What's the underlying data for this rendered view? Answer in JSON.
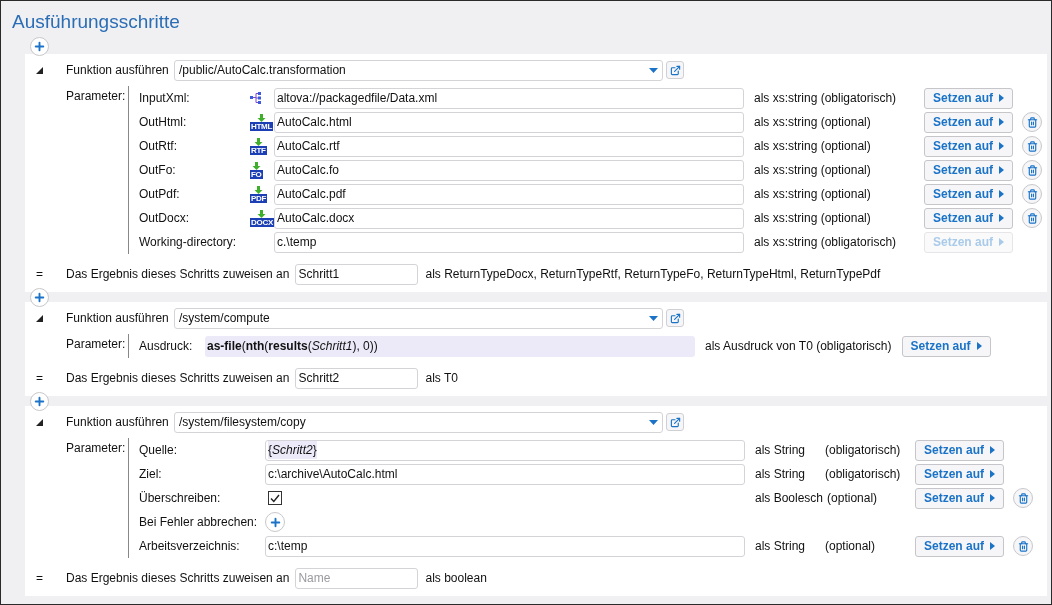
{
  "title": "Ausführungsschritte",
  "steps": [
    {
      "kind": "transformation",
      "expanded": true,
      "function_label": "Funktion ausführen",
      "function_path": "/public/AutoCalc.transformation",
      "parameters_label": "Parameter:",
      "params": [
        {
          "kind": "input_file",
          "name": "InputXml:",
          "value": "altova://packagedfile/Data.xml",
          "type": "als xs:string (obligatorisch)",
          "button": {
            "label": "Setzen auf",
            "disabled": false
          },
          "deletable": false
        },
        {
          "kind": "output_file",
          "name": "OutHtml:",
          "icon_label": "HTML",
          "value": "AutoCalc.html",
          "type": "als xs:string (optional)",
          "button": {
            "label": "Setzen auf",
            "disabled": false
          },
          "deletable": true
        },
        {
          "kind": "output_file",
          "name": "OutRtf:",
          "icon_label": "RTF",
          "value": "AutoCalc.rtf",
          "type": "als xs:string (optional)",
          "button": {
            "label": "Setzen auf",
            "disabled": false
          },
          "deletable": true
        },
        {
          "kind": "output_file",
          "name": "OutFo:",
          "icon_label": "FO",
          "value": "AutoCalc.fo",
          "type": "als xs:string (optional)",
          "button": {
            "label": "Setzen auf",
            "disabled": false
          },
          "deletable": true
        },
        {
          "kind": "output_file",
          "name": "OutPdf:",
          "icon_label": "PDF",
          "value": "AutoCalc.pdf",
          "type": "als xs:string (optional)",
          "button": {
            "label": "Setzen auf",
            "disabled": false
          },
          "deletable": true
        },
        {
          "kind": "output_file",
          "name": "OutDocx:",
          "icon_label": "DOCX",
          "value": "AutoCalc.docx",
          "type": "als xs:string (optional)",
          "button": {
            "label": "Setzen auf",
            "disabled": false
          },
          "deletable": true
        },
        {
          "kind": "field",
          "name": "Working-directory:",
          "value": "c.\\temp",
          "type": "als xs:string (obligatorisch)",
          "button": {
            "label": "Setzen auf",
            "disabled": true
          },
          "deletable": false
        }
      ],
      "result": {
        "symbol": "=",
        "label": "Das Ergebnis dieses Schritts zuweisen an",
        "value": "Schritt1",
        "type": "als ReturnTypeDocx, ReturnTypeRtf, ReturnTypeFo, ReturnTypeHtml, ReturnTypePdf"
      }
    },
    {
      "kind": "compute",
      "expanded": true,
      "function_label": "Funktion ausführen",
      "function_path": "/system/compute",
      "parameters_label": "Parameter:",
      "params": [
        {
          "kind": "expression",
          "name": "Ausdruck:",
          "value": "**as-file**(**nth**(**results**(*Schritt1*), 0))",
          "type": "als Ausdruck von T0 (obligatorisch)",
          "button": {
            "label": "Setzen auf",
            "disabled": false
          },
          "deletable": false
        }
      ],
      "result": {
        "symbol": "=",
        "label": "Das Ergebnis dieses Schritts zuweisen an",
        "value": "Schritt2",
        "type": "als T0"
      }
    },
    {
      "kind": "copy",
      "expanded": true,
      "function_label": "Funktion ausführen",
      "function_path": "/system/filesystem/copy",
      "parameters_label": "Parameter:",
      "params": [
        {
          "kind": "field",
          "name": "Quelle:",
          "value": "{*Schritt2*}",
          "highlighted": true,
          "type": "als String",
          "requirement": "(obligatorisch)",
          "button": {
            "label": "Setzen auf",
            "disabled": false
          },
          "deletable": false
        },
        {
          "kind": "field",
          "name": "Ziel:",
          "value": "c:\\archive\\AutoCalc.html",
          "highlighted": false,
          "type": "als String",
          "requirement": "(obligatorisch)",
          "button": {
            "label": "Setzen auf",
            "disabled": false
          },
          "deletable": false
        },
        {
          "kind": "checkbox",
          "name": "Überschreiben:",
          "checked": true,
          "type": "als Boolesch",
          "requirement": "(optional)",
          "button": {
            "label": "Setzen auf",
            "disabled": false
          },
          "deletable": true
        },
        {
          "kind": "add",
          "name": "Bei Fehler abbrechen:"
        },
        {
          "kind": "field",
          "name": "Arbeitsverzeichnis:",
          "value": "c:\\temp",
          "highlighted": false,
          "type": "als String",
          "requirement": "(optional)",
          "button": {
            "label": "Setzen auf",
            "disabled": false
          },
          "deletable": true
        }
      ],
      "result": {
        "symbol": "=",
        "label": "Das Ergebnis dieses Schritts zuweisen an",
        "placeholder": "Name",
        "type": "als boolean"
      }
    }
  ]
}
